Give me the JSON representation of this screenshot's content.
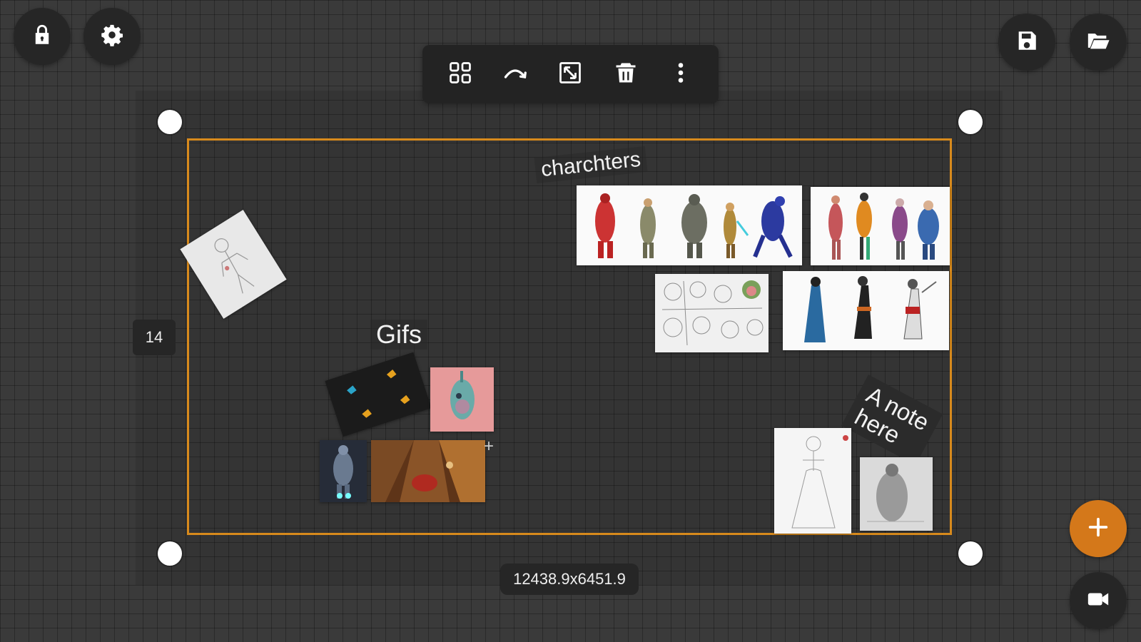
{
  "toolbar": {
    "buttons": [
      {
        "name": "group-button",
        "icon": "grid-icon"
      },
      {
        "name": "connect-button",
        "icon": "curve-arrow-icon"
      },
      {
        "name": "resize-button",
        "icon": "resize-icon"
      },
      {
        "name": "delete-button",
        "icon": "trash-icon"
      },
      {
        "name": "more-button",
        "icon": "more-vertical-icon"
      }
    ]
  },
  "top_left": {
    "lock_icon": "lock-icon",
    "settings_icon": "gear-icon"
  },
  "top_right": {
    "save_icon": "save-icon",
    "open_icon": "folder-open-icon"
  },
  "canvas": {
    "side_badge": "14",
    "dimensions": "12438.9x6451.9",
    "notes": {
      "characters": "charchters",
      "gifs": "Gifs",
      "note": "A note\nhere"
    }
  },
  "colors": {
    "accent": "#d88a1c",
    "background": "#3a3a3a",
    "button": "#262626"
  },
  "fab": {
    "add_icon": "plus-icon",
    "record_icon": "video-camera-icon"
  }
}
